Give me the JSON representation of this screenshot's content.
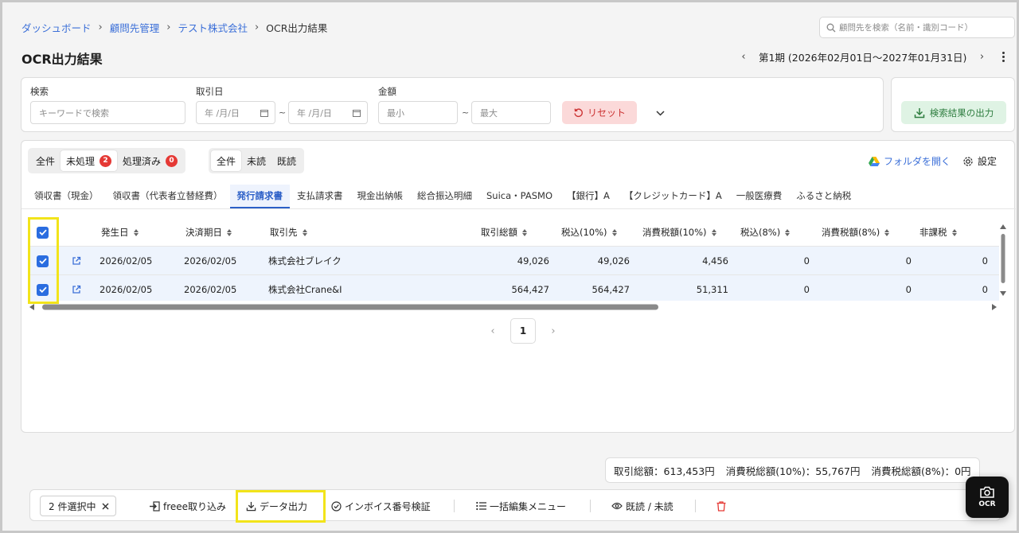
{
  "breadcrumb": {
    "items": [
      "ダッシュボード",
      "顧問先管理",
      "テスト株式会社"
    ],
    "current": "OCR出力結果"
  },
  "top_search": {
    "placeholder": "顧問先を検索（名前・識別コード）"
  },
  "page_title": "OCR出力結果",
  "period": {
    "label": "第1期 (2026年02月01日〜2027年01月31日)"
  },
  "filters": {
    "search_label": "検索",
    "search_placeholder": "キーワードで検索",
    "date_label": "取引日",
    "date_from": "年 /月/日",
    "date_to": "年 /月/日",
    "amount_label": "金額",
    "amount_min": "最小",
    "amount_max": "最大",
    "tilde": "~",
    "reset_label": "リセット"
  },
  "export": {
    "label": "検索結果の出力"
  },
  "status_filter": {
    "all": "全件",
    "unprocessed": "未処理",
    "unprocessed_count": "2",
    "processed": "処理済み",
    "processed_count": "0"
  },
  "read_filter": {
    "all": "全件",
    "unread": "未読",
    "read": "既読"
  },
  "folder_link": "フォルダを開く",
  "settings_label": "設定",
  "tabs": [
    "領収書（現金）",
    "領収書（代表者立替経費）",
    "発行請求書",
    "支払請求書",
    "現金出納帳",
    "総合振込明細",
    "Suica・PASMO",
    "【銀行】A",
    "【クレジットカード】A",
    "一般医療費",
    "ふるさと納税"
  ],
  "active_tab": "発行請求書",
  "table": {
    "columns": {
      "issue_date": "発生日",
      "due_date": "決済期日",
      "partner": "取引先",
      "total": "取引総額",
      "taxed10": "税込(10%)",
      "ctax10": "消費税額(10%)",
      "taxed8": "税込(8%)",
      "ctax8": "消費税額(8%)",
      "nontax": "非課税"
    },
    "rows": [
      {
        "issue_date": "2026/02/05",
        "due_date": "2026/02/05",
        "partner": "株式会社ブレイク",
        "total": "49,026",
        "taxed10": "49,026",
        "ctax10": "4,456",
        "taxed8": "0",
        "ctax8": "0",
        "nontax": "0"
      },
      {
        "issue_date": "2026/02/05",
        "due_date": "2026/02/05",
        "partner": "株式会社Crane&I",
        "total": "564,427",
        "taxed10": "564,427",
        "ctax10": "51,311",
        "taxed8": "0",
        "ctax8": "0",
        "nontax": "0"
      }
    ]
  },
  "pagination": {
    "current": "1"
  },
  "totals": {
    "total": "取引総額：613,453円",
    "ctax10": "消費税総額(10%)：55,767円",
    "ctax8": "消費税総額(8%)：0円"
  },
  "bottom_bar": {
    "selected": "2 件選択中",
    "freee": "freee取り込み",
    "data_export": "データ出力",
    "invoice_check": "インボイス番号検証",
    "bulk_edit": "一括編集メニュー",
    "read_unread": "既読 / 未読"
  },
  "ocr_button": "OCR",
  "colors": {
    "accent": "#2a6de0",
    "link": "#3b6fd8",
    "danger": "#e53935",
    "highlight": "#f2e41a",
    "export_green": "#2e7d3f"
  }
}
